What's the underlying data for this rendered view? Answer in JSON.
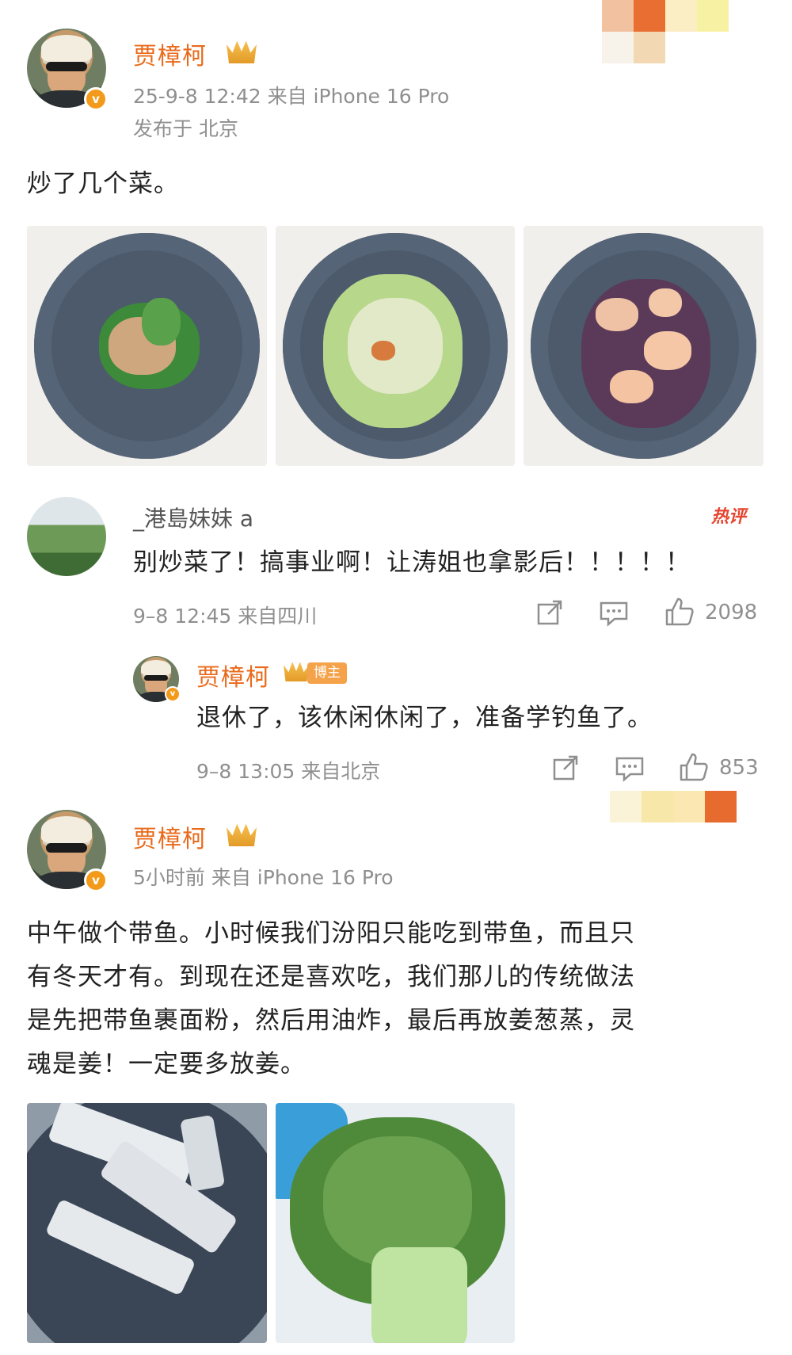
{
  "post1": {
    "author": "贾樟柯",
    "meta_line": "25-9-8 12:42  来自 iPhone 16 Pro",
    "location_line": "发布于 北京",
    "text": "炒了几个菜。",
    "photos": [
      "photo-snowpea-chicken",
      "photo-fried-cucumber",
      "photo-shrimp-salad"
    ]
  },
  "comment1": {
    "author": "_港島妹妹 a",
    "hot_label": "热评",
    "text": "别炒菜了！搞事业啊！让涛姐也拿影后！！！！！",
    "meta": "9–8 12:45  来自四川",
    "likes": "2098"
  },
  "reply1": {
    "author": "贾樟柯",
    "badge": "博主",
    "text": "退休了，该休闲休闲了，准备学钓鱼了。",
    "meta": "9–8 13:05  来自北京",
    "likes": "853"
  },
  "post2": {
    "author": "贾樟柯",
    "meta_line": "5小时前   来自 iPhone 16 Pro",
    "text_lines": [
      "中午做个带鱼。小时候我们汾阳只能吃到带鱼，而且只",
      "有冬天才有。到现在还是喜欢吃，我们那儿的传统做法",
      "是先把带鱼裹面粉，然后用油炸，最后再放姜葱蒸，灵",
      "魂是姜！一定要多放姜。"
    ],
    "photos": [
      "photo-hairtail-fish",
      "photo-green-vegetables"
    ]
  },
  "icons": [
    "share-icon",
    "comment-icon",
    "like-icon",
    "verified-v-icon",
    "crown-icon"
  ],
  "colors": {
    "name": "#e96a1b",
    "meta": "#8f8f8f",
    "hot": "#e6452f",
    "badge": "#f5a34b",
    "vbadge": "#f39a1b"
  }
}
